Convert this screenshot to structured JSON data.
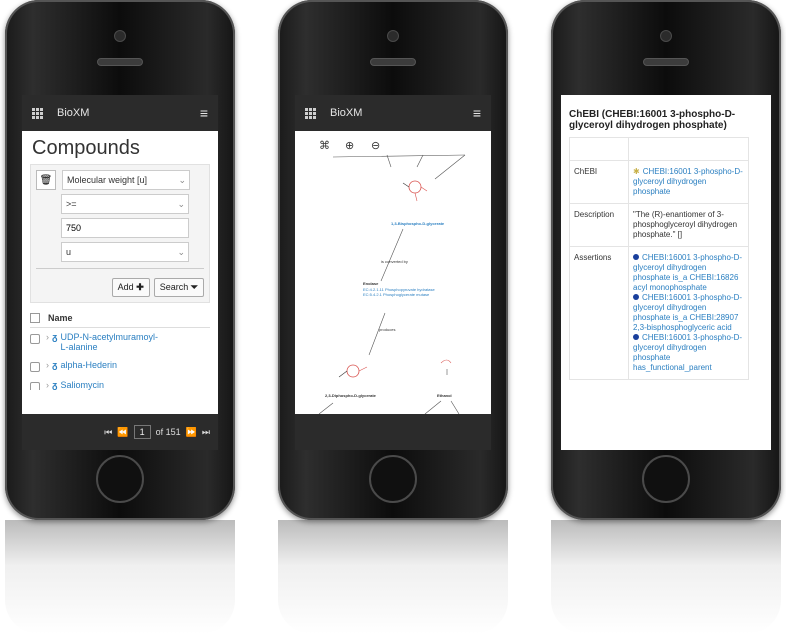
{
  "app": {
    "name": "BioXM"
  },
  "compounds": {
    "title": "Compounds",
    "filter": {
      "field": "Molecular weight [u]",
      "operator": ">=",
      "value": "750",
      "unit": "u",
      "add_label": "Add",
      "search_label": "Search"
    },
    "list": {
      "header": "Name",
      "items": [
        {
          "name_line1": "UDP-N-acetylmuramoyl-",
          "name_line2": "L-alanine"
        },
        {
          "name_line1": "alpha-Hederin",
          "name_line2": ""
        },
        {
          "name_line1": "Saliomycin",
          "name_line2": ""
        }
      ]
    },
    "pager": {
      "current": "1",
      "total_label": "of 151"
    }
  },
  "pathway": {
    "labels": {
      "node1": "1,3-Bisphospho-D-glycerate",
      "reaction": "is converted by",
      "enzyme": "Enolase",
      "enzyme_sub1": "EC:4.2.1.11 Phosphopyruvate hydratase",
      "enzyme_sub2": "EC:5.4.2.1 Phosphoglycerate mutase",
      "produces": "produces",
      "node2": "2,3-Diphospho-D-glycerate",
      "node3": "Ethanol"
    }
  },
  "chebi": {
    "title": "ChEBI (CHEBI:16001 3-phospho-D-glyceroyl dihydrogen phosphate)",
    "rows": {
      "chebi_key": "ChEBI",
      "chebi_value": "CHEBI:16001 3-phospho-D-glyceroyl dihydrogen phosphate",
      "description_key": "Description",
      "description_value": "\"The (R)-enantiomer of 3-phosphoglyceroyl dihydrogen phosphate.\" []",
      "assertions_key": "Assertions",
      "assertions": [
        "CHEBI:16001 3-phospho-D-glyceroyl dihydrogen phosphate is_a CHEBI:16826 acyl monophosphate",
        "CHEBI:16001 3-phospho-D-glyceroyl dihydrogen phosphate is_a CHEBI:28907 2,3-bisphosphoglyceric acid",
        "CHEBI:16001 3-phospho-D-glyceroyl dihydrogen phosphate has_functional_parent"
      ]
    }
  }
}
